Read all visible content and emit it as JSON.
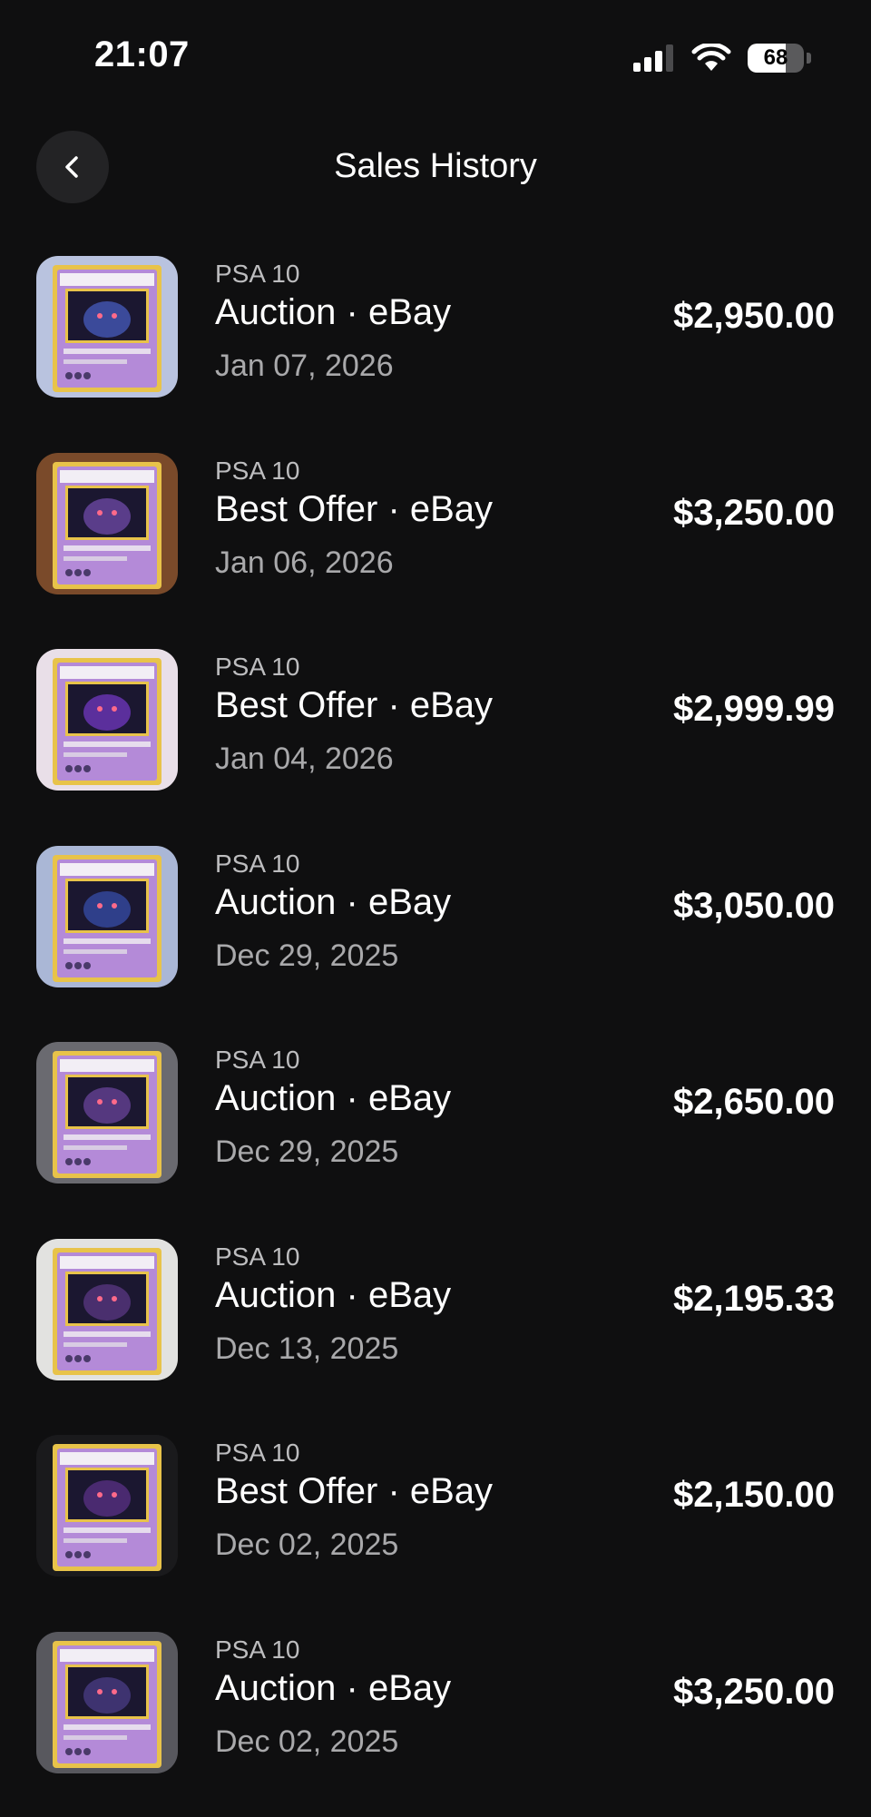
{
  "status_bar": {
    "time": "21:07",
    "battery_percent": "68",
    "battery_level": 0.68
  },
  "header": {
    "title": "Sales History",
    "back_icon": "chevron-left-icon"
  },
  "sales": [
    {
      "grade": "PSA 10",
      "type": "Auction",
      "platform": "eBay",
      "label": "Auction · eBay",
      "date": "Jan 07, 2026",
      "price": "$2,950.00",
      "frame": "#b9c3df",
      "art": "#3b4a9a"
    },
    {
      "grade": "PSA 10",
      "type": "Best Offer",
      "platform": "eBay",
      "label": "Best Offer · eBay",
      "date": "Jan 06, 2026",
      "price": "$3,250.00",
      "frame": "#7a4a2a",
      "art": "#5a3d8a"
    },
    {
      "grade": "PSA 10",
      "type": "Best Offer",
      "platform": "eBay",
      "label": "Best Offer · eBay",
      "date": "Jan 04, 2026",
      "price": "$2,999.99",
      "frame": "#e9dfe8",
      "art": "#5b2f9c"
    },
    {
      "grade": "PSA 10",
      "type": "Auction",
      "platform": "eBay",
      "label": "Auction · eBay",
      "date": "Dec 29, 2025",
      "price": "$3,050.00",
      "frame": "#aab7d6",
      "art": "#2f3f8a"
    },
    {
      "grade": "PSA 10",
      "type": "Auction",
      "platform": "eBay",
      "label": "Auction · eBay",
      "date": "Dec 29, 2025",
      "price": "$2,650.00",
      "frame": "#6a6a70",
      "art": "#55387f"
    },
    {
      "grade": "PSA 10",
      "type": "Auction",
      "platform": "eBay",
      "label": "Auction · eBay",
      "date": "Dec 13, 2025",
      "price": "$2,195.33",
      "frame": "#e2e2e0",
      "art": "#4a2f6e"
    },
    {
      "grade": "PSA 10",
      "type": "Best Offer",
      "platform": "eBay",
      "label": "Best Offer · eBay",
      "date": "Dec 02, 2025",
      "price": "$2,150.00",
      "frame": "#1a1a1c",
      "art": "#4a2a70"
    },
    {
      "grade": "PSA 10",
      "type": "Auction",
      "platform": "eBay",
      "label": "Auction · eBay",
      "date": "Dec 02, 2025",
      "price": "$3,250.00",
      "frame": "#58585e",
      "art": "#3e3370"
    }
  ],
  "colors": {
    "background": "#0f0f10",
    "primary_text": "#ffffff",
    "secondary_text": "#a9a9ab",
    "card_yellow": "#e8c34a",
    "card_purple": "#b48ad8"
  }
}
